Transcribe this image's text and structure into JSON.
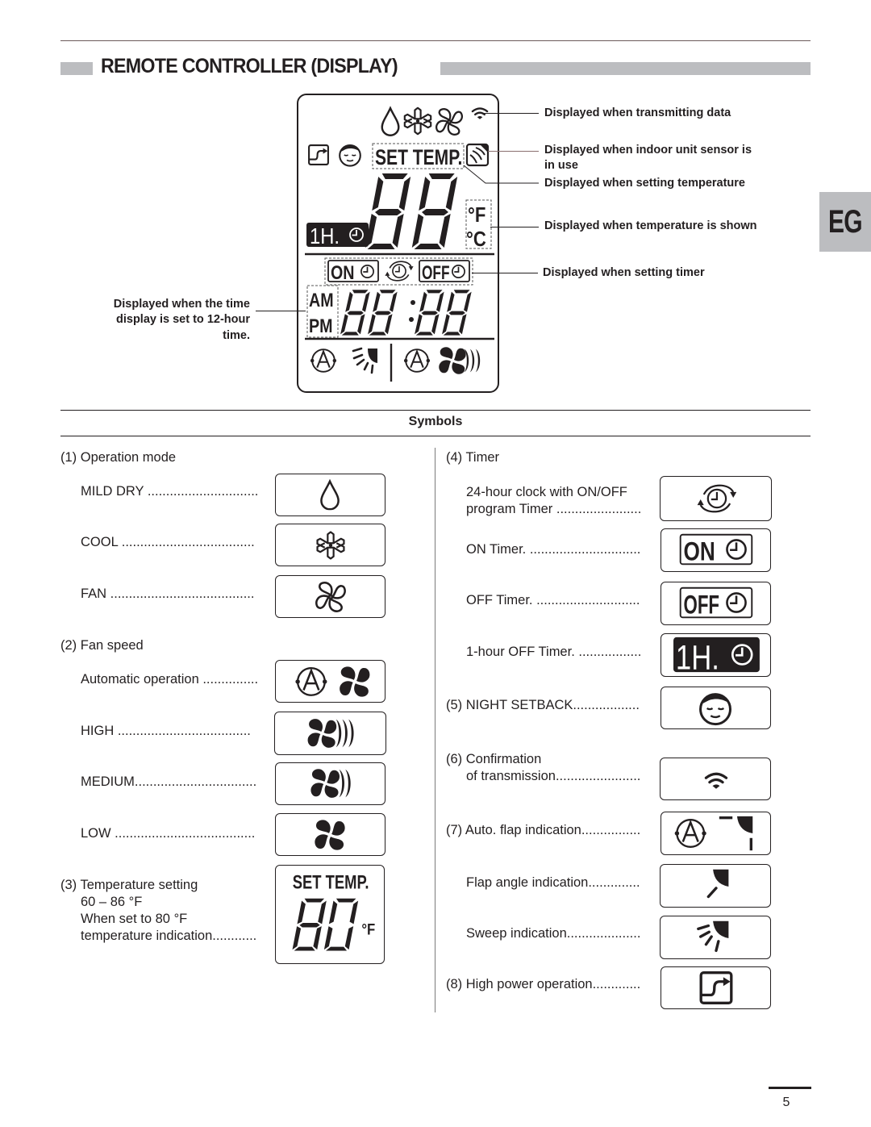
{
  "header": {
    "title": "REMOTE CONTROLLER (DISPLAY)",
    "side_tab": "EG"
  },
  "display_diagram": {
    "lcd_texts": {
      "set_temp": "SET TEMP.",
      "deg_f": "°F",
      "deg_c": "°C",
      "one_hour": "1H.",
      "on": "ON",
      "off": "OFF",
      "am": "AM",
      "pm": "PM"
    },
    "icons": [
      "drop-icon",
      "snowflake-icon",
      "fan-icon",
      "transmission-icon",
      "high-power-icon",
      "night-face-icon",
      "sensor-icon",
      "clock-icon",
      "auto-icon",
      "sweep-flap-icon",
      "fan-speed-icon"
    ],
    "callouts": {
      "transmitting": "Displayed when transmitting data",
      "sensor_line1": "Displayed when indoor unit sensor is",
      "sensor_line2": "in use",
      "setting_temp": "Displayed when setting temperature",
      "temp_shown": "Displayed when temperature is shown",
      "setting_timer": "Displayed when setting timer",
      "twelve_hour_line1": "Displayed when the time",
      "twelve_hour_line2": "display is set to 12-hour",
      "twelve_hour_line3": "time."
    }
  },
  "symbols": {
    "title": "Symbols",
    "left": {
      "operation_mode": {
        "heading": "(1) Operation mode",
        "items": [
          {
            "label": "MILD DRY ..............................",
            "icon": "drop-icon"
          },
          {
            "label": "COOL ....................................",
            "icon": "snowflake-icon"
          },
          {
            "label": "FAN .......................................",
            "icon": "fan-icon"
          }
        ]
      },
      "fan_speed": {
        "heading": "(2) Fan speed",
        "items": [
          {
            "label": "Automatic operation ...............",
            "icon": "auto-fan-icon"
          },
          {
            "label": "HIGH ....................................",
            "icon": "fan-high-icon"
          },
          {
            "label": "MEDIUM.................................",
            "icon": "fan-medium-icon"
          },
          {
            "label": "LOW ......................................",
            "icon": "fan-low-icon"
          }
        ]
      },
      "temperature": {
        "heading": "(3) Temperature setting",
        "range": "60 – 86 °F",
        "line2": "When set to 80 °F",
        "line3": "temperature indication............",
        "icon_title": "SET TEMP.",
        "icon_value": "80",
        "icon_unit": "°F"
      }
    },
    "right": {
      "timer": {
        "heading": "(4) Timer",
        "items": [
          {
            "label_line1": "24-hour clock with ON/OFF",
            "label_line2": "program Timer .......................",
            "icon": "cycle-clock-icon"
          },
          {
            "label": "ON Timer. ..............................",
            "icon": "on-timer-icon",
            "icon_text": "ON"
          },
          {
            "label": "OFF Timer. ............................",
            "icon": "off-timer-icon",
            "icon_text": "OFF"
          },
          {
            "label": "1-hour OFF Timer. .................",
            "icon": "one-hour-timer-icon",
            "icon_text": "1H."
          }
        ]
      },
      "night_setback": {
        "label": "(5) NIGHT SETBACK..................",
        "icon": "night-face-icon"
      },
      "confirmation": {
        "line1": "(6) Confirmation",
        "line2": "of transmission.......................",
        "icon": "transmission-icon"
      },
      "auto_flap": {
        "label": "(7) Auto. flap indication................",
        "icon": "auto-flap-icon"
      },
      "flap_angle": {
        "label": "Flap angle indication..............",
        "icon": "flap-angle-icon"
      },
      "sweep": {
        "label": "Sweep indication....................",
        "icon": "sweep-icon"
      },
      "high_power": {
        "label": "(8) High power operation.............",
        "icon": "high-power-icon"
      }
    }
  },
  "footer": {
    "page_number": "5"
  }
}
